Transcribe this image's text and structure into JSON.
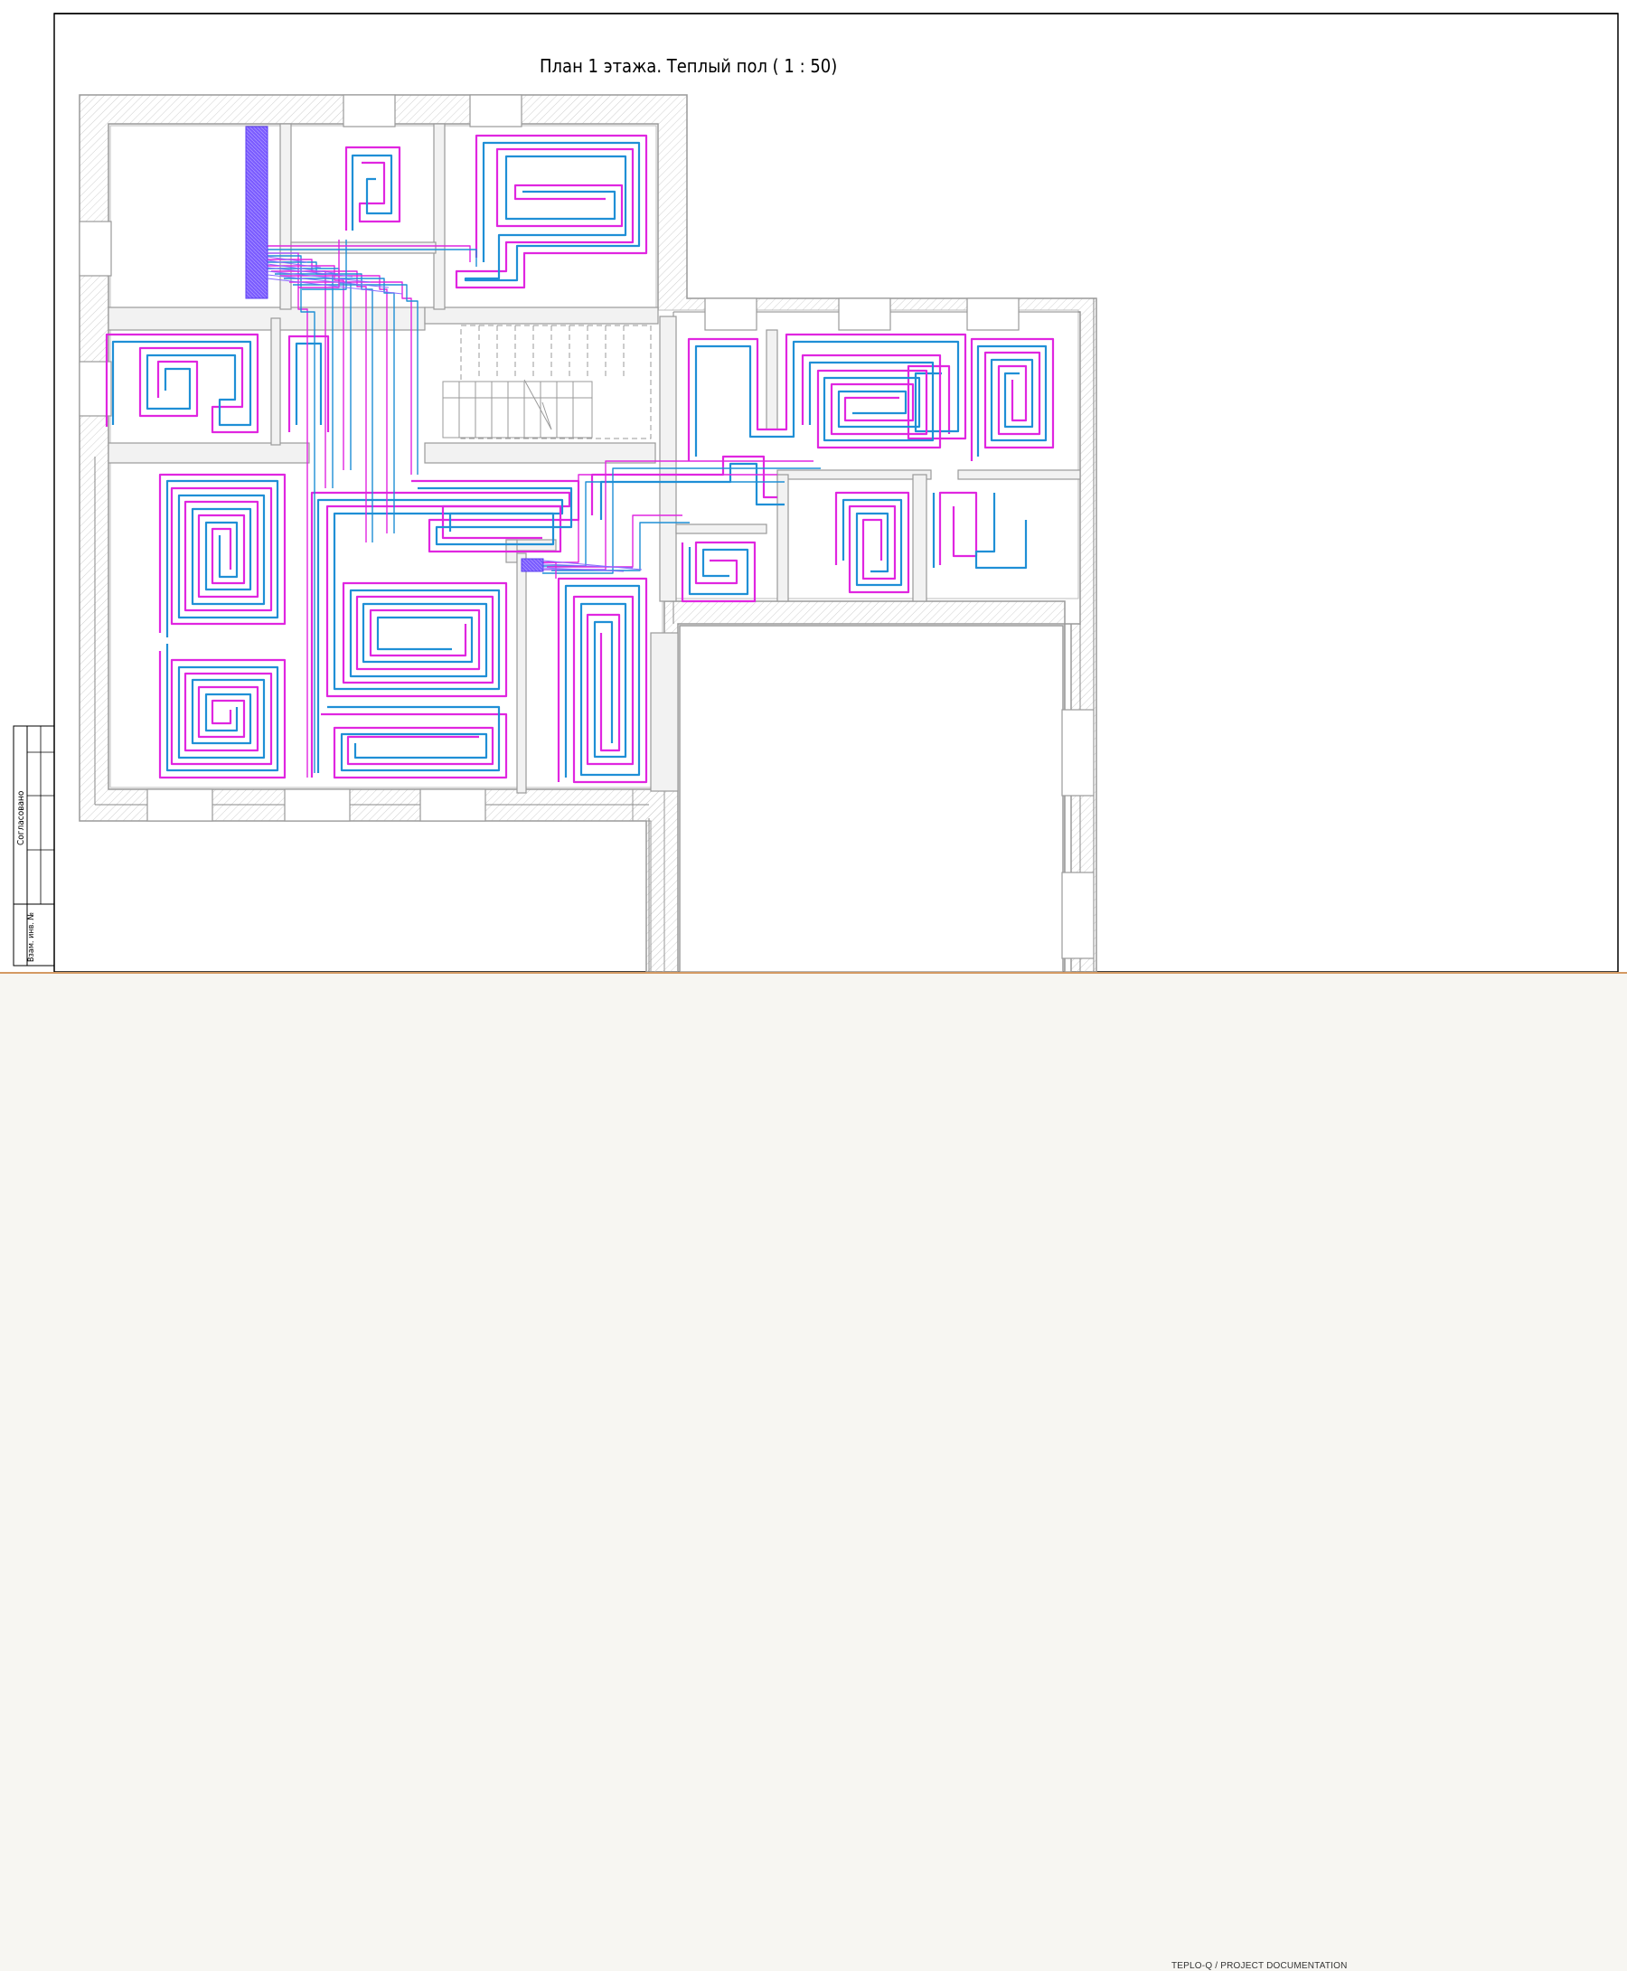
{
  "drawing": {
    "title": "План 1 этажа. Теплый пол ( 1 : 50)",
    "side_stamp_agreed": "Согласовано",
    "side_stamp_inv": "Взам. инв. №"
  },
  "footer": {
    "label": "TEPLO-Q / PROJECT DOCUMENTATION"
  },
  "colors": {
    "supply_pipe": "#e026e0",
    "return_pipe": "#1f8fd6",
    "manifold": "#6d4cff",
    "wall": "#9a9a9a",
    "frame": "#000000"
  }
}
